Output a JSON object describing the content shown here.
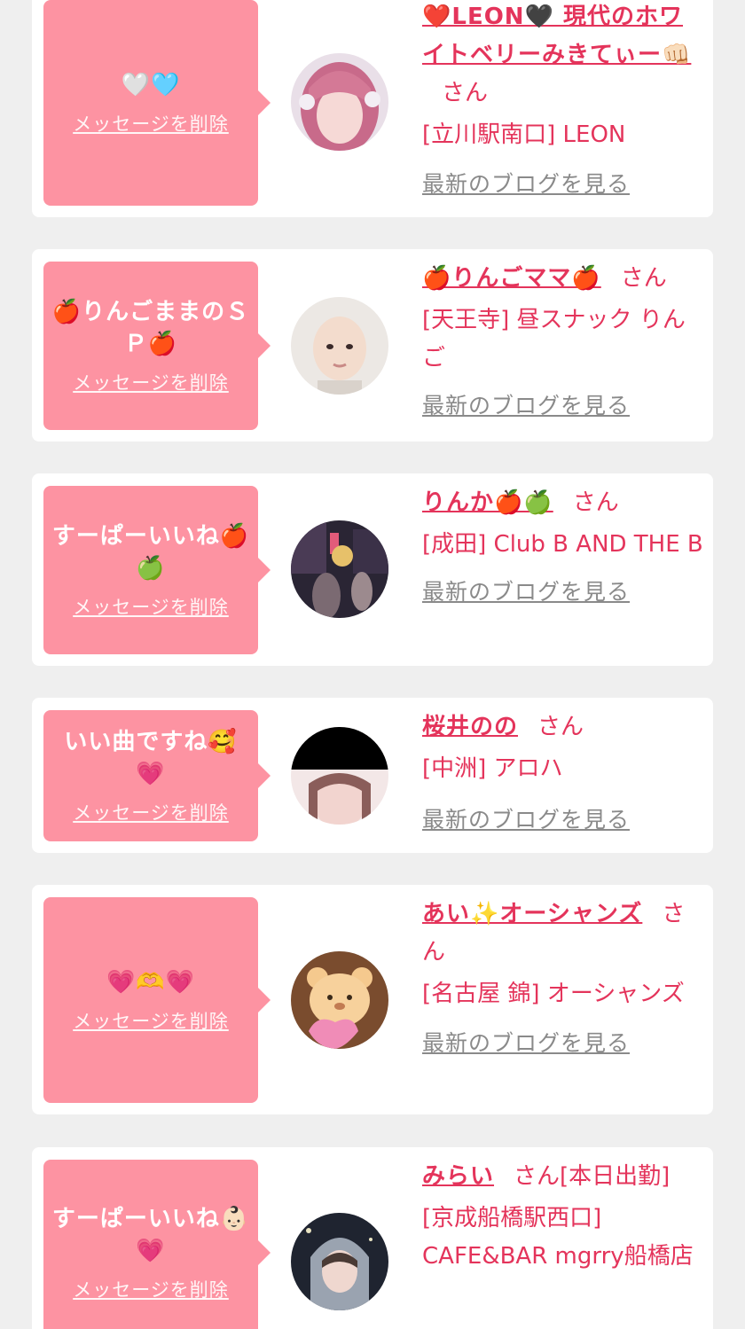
{
  "delete_label": "メッセージを削除",
  "san_label": "さん",
  "blog_label": "最新のブログを見る",
  "colors": {
    "background": "#efefef",
    "card": "#ffffff",
    "bubble": "#fd93a2",
    "accent": "#e4345b",
    "link_gray": "#8a8a8a"
  },
  "items": [
    {
      "message": "🤍🩵",
      "name": "❤️LEON🖤 現代のホワイトベリーみきてぃー👊🏻",
      "extra": "",
      "shop": "[立川駅南口] LEON",
      "avatar": "avatar-pink-hair"
    },
    {
      "message": "🍎りんごままのＳＰ🍎",
      "name": "🍎りんごママ🍎",
      "extra": "",
      "shop": "[天王寺] 昼スナック りんご",
      "avatar": "avatar-bald-face"
    },
    {
      "message": "すーぱーいいね🍎🍏",
      "name": "りんか🍎🍏",
      "extra": "",
      "shop": "[成田] Club B AND THE B",
      "avatar": "avatar-night-street"
    },
    {
      "message": "いい曲ですね🥰💗",
      "name": "桜井のの",
      "extra": "",
      "shop": "[中洲] アロハ",
      "avatar": "avatar-dark-top"
    },
    {
      "message": "💗🫶💗",
      "name": "あい✨オーシャンズ",
      "extra": "",
      "shop": "[名古屋 錦] オーシャンズ",
      "avatar": "avatar-bear"
    },
    {
      "message": "すーぱーいいね👶🏻💗",
      "name": "みらい",
      "extra": "[本日出勤]",
      "shop": "[京成船橋駅西口] CAFE&BAR mgrry船橋店",
      "avatar": "avatar-hood"
    }
  ]
}
